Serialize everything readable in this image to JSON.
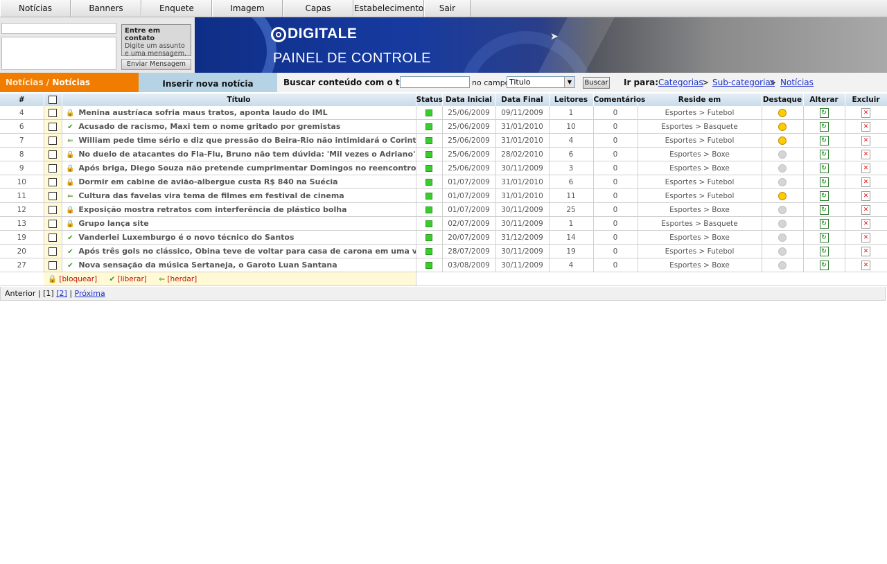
{
  "nav": [
    "Notícias",
    "Banners",
    "Enquete",
    "Imagem",
    "Capas",
    "Estabelecimentos",
    "Sair"
  ],
  "contact": {
    "title": "Entre em contato",
    "text": "Digite um assunto e uma mensagem.",
    "send_label": "Enviar Mensagem"
  },
  "banner": {
    "brand": "DIGITALE",
    "subtitle": "PAINEL DE CONTROLE"
  },
  "breadcrumb": {
    "section": "Notícias",
    "sep": " / ",
    "current": "Notícias"
  },
  "insert_label": "Inserir nova notícia",
  "search": {
    "label": "Buscar conteúdo com o texto",
    "field_label": "no campo",
    "field_value": "Titulo",
    "button": "Buscar",
    "goto_label": "Ir para:",
    "goto_links": [
      "Categorias",
      "Sub-categorias",
      "Notícias"
    ],
    "goto_sep": ">"
  },
  "table": {
    "headers": [
      "#",
      "",
      "Título",
      "Status",
      "Data Inicial",
      "Data Final",
      "Leitores",
      "Comentários",
      "Reside em",
      "Destaque",
      "Alterar",
      "Excluir"
    ],
    "rows": [
      {
        "id": "4",
        "icon": "lock",
        "title": "Menina austríaca sofria maus tratos, aponta laudo do IML",
        "start": "25/06/2009",
        "end": "09/11/2009",
        "readers": "1",
        "comments": "0",
        "section": "Esportes > Futebol",
        "featured": true
      },
      {
        "id": "6",
        "icon": "check",
        "title": "Acusado de racismo, Maxi tem o nome gritado por gremistas",
        "start": "25/06/2009",
        "end": "31/01/2010",
        "readers": "10",
        "comments": "0",
        "section": "Esportes > Basquete",
        "featured": true
      },
      {
        "id": "7",
        "icon": "arrow",
        "title": "William pede time sério e diz que pressão do Beira-Rio não intimidará o Corinthians",
        "start": "25/06/2009",
        "end": "31/01/2010",
        "readers": "4",
        "comments": "0",
        "section": "Esportes > Futebol",
        "featured": true
      },
      {
        "id": "8",
        "icon": "lock",
        "title": "No duelo de atacantes do Fla-Flu, Bruno não tem dúvida: 'Mil vezes o Adriano'",
        "start": "25/06/2009",
        "end": "28/02/2010",
        "readers": "6",
        "comments": "0",
        "section": "Esportes > Boxe",
        "featured": false
      },
      {
        "id": "9",
        "icon": "lock",
        "title": "Após briga, Diego Souza não pretende cumprimentar Domingos no reencontro",
        "start": "25/06/2009",
        "end": "30/11/2009",
        "readers": "3",
        "comments": "0",
        "section": "Esportes > Boxe",
        "featured": false
      },
      {
        "id": "10",
        "icon": "lock",
        "title": "Dormir em cabine de avião-albergue custa R$ 840 na Suécia",
        "start": "01/07/2009",
        "end": "31/01/2010",
        "readers": "6",
        "comments": "0",
        "section": "Esportes > Futebol",
        "featured": false
      },
      {
        "id": "11",
        "icon": "arrow",
        "title": "Cultura das favelas vira tema de filmes em festival de cinema",
        "start": "01/07/2009",
        "end": "31/01/2010",
        "readers": "11",
        "comments": "0",
        "section": "Esportes > Futebol",
        "featured": true
      },
      {
        "id": "12",
        "icon": "lock",
        "title": "Exposição mostra retratos com interferência de plástico bolha",
        "start": "01/07/2009",
        "end": "30/11/2009",
        "readers": "25",
        "comments": "0",
        "section": "Esportes > Boxe",
        "featured": false
      },
      {
        "id": "13",
        "icon": "lock",
        "title": "Grupo lança site",
        "start": "02/07/2009",
        "end": "30/11/2009",
        "readers": "1",
        "comments": "0",
        "section": "Esportes > Basquete",
        "featured": false
      },
      {
        "id": "19",
        "icon": "check",
        "title": "Vanderlei Luxemburgo é o novo técnico do Santos",
        "start": "20/07/2009",
        "end": "31/12/2009",
        "readers": "14",
        "comments": "0",
        "section": "Esportes > Boxe",
        "featured": false
      },
      {
        "id": "20",
        "icon": "check",
        "title": "Após três gols no clássico, Obina teve de voltar para casa de carona em uma van",
        "start": "28/07/2009",
        "end": "30/11/2009",
        "readers": "19",
        "comments": "0",
        "section": "Esportes > Futebol",
        "featured": false
      },
      {
        "id": "27",
        "icon": "check",
        "title": "Nova sensação da música Sertaneja, o Garoto Luan Santana",
        "start": "03/08/2009",
        "end": "30/11/2009",
        "readers": "4",
        "comments": "0",
        "section": "Esportes > Boxe",
        "featured": false
      }
    ]
  },
  "legend": {
    "lock": "[bloquear]",
    "check": "[liberar]",
    "arrow": "[herdar]"
  },
  "pager": {
    "prev": "Anterior",
    "current": "[1]",
    "page2": "[2]",
    "next": "Próxima",
    "sep": "|"
  },
  "colors": {
    "crumb_bg": "#f07c00",
    "insert_bg": "#b5d3e5",
    "status_green": "#3bcb2e",
    "featured_on": "#ffcc00",
    "featured_off": "#d5d5d5"
  }
}
